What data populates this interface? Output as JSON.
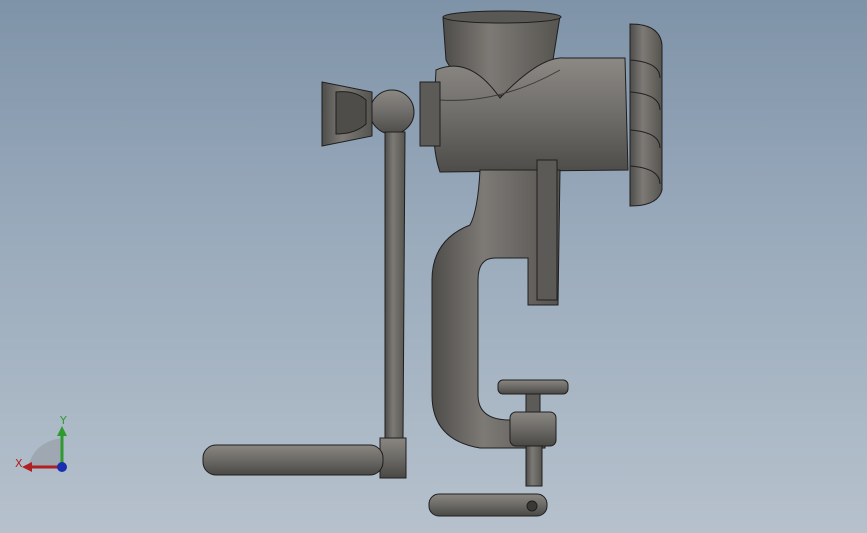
{
  "viewport": {
    "background_top": "#7f93a8",
    "background_bottom": "#b6c1cc"
  },
  "model": {
    "description_icon": "meat-grinder-icon",
    "body_color": "#6f6d6a",
    "shadow_color": "#4a4845",
    "highlight_color": "#8e8b86",
    "edge_color": "#1f1f1f"
  },
  "triad": {
    "x_label": "X",
    "y_label": "Y",
    "x_color": "#b02020",
    "y_color": "#2f9a2f",
    "z_color": "#1a2fb0"
  }
}
